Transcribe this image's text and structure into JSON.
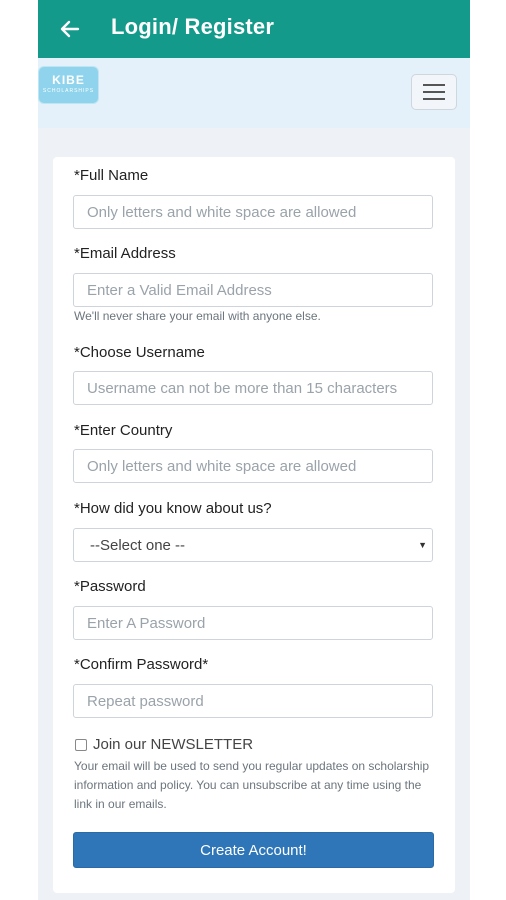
{
  "appbar": {
    "title": "Login/ Register",
    "back_icon": "arrow-left-icon",
    "color": "#139a8a"
  },
  "nav": {
    "logo_text": "KIBE",
    "logo_subtext": "SCHOLARSHIPS",
    "menu_icon": "hamburger-menu-icon"
  },
  "form": {
    "full_name": {
      "label": "*Full Name",
      "placeholder": "Only letters and white space are allowed"
    },
    "email": {
      "label": "*Email Address",
      "placeholder": "Enter a Valid Email Address",
      "help": "We'll never share your email with anyone else."
    },
    "username": {
      "label": "*Choose Username",
      "placeholder": "Username can not be more than 15 characters"
    },
    "country": {
      "label": "*Enter Country",
      "placeholder": "Only letters and white space are allowed"
    },
    "source": {
      "label": "*How did you know about us?",
      "selected": "--Select one --"
    },
    "password": {
      "label": "*Password",
      "placeholder": "Enter A Password"
    },
    "confirm_password": {
      "label": "*Confirm Password*",
      "placeholder": "Repeat password"
    },
    "newsletter": {
      "label": "Join our NEWSLETTER",
      "checked": false,
      "help": "Your email will be used to send you regular updates on scholarship information and policy. You can unsubscribe at any time using the link in our emails."
    },
    "submit_label": "Create Account!",
    "button_color": "#2f76b8"
  }
}
